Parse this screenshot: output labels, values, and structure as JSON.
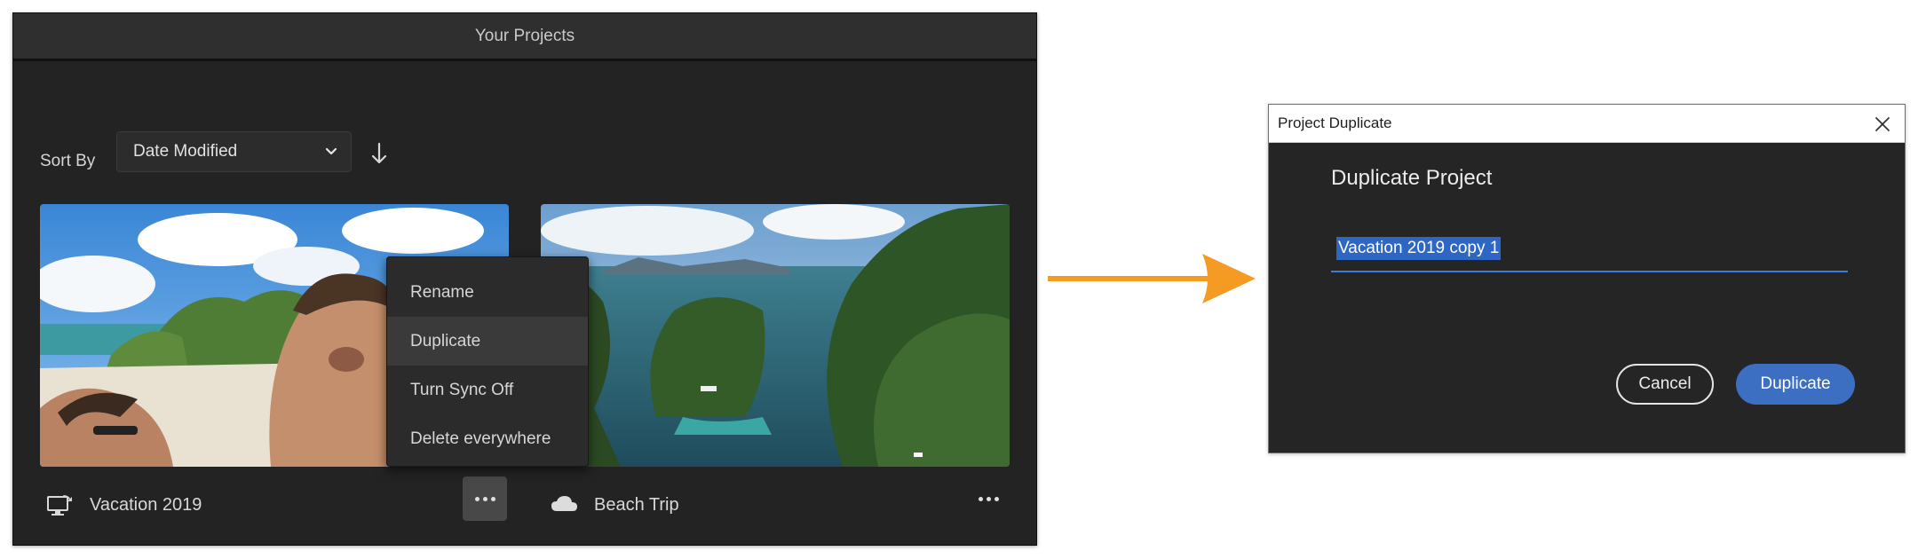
{
  "projects_panel": {
    "title": "Your Projects",
    "sort_label": "Sort By",
    "sort_value": "Date Modified",
    "sort_icon": "chevron-down-icon",
    "sort_direction_icon": "arrow-down-icon",
    "projects": [
      {
        "name": "Vacation 2019",
        "icon": "desktop-sync-icon",
        "more_icon": "more-icon"
      },
      {
        "name": "Beach Trip",
        "icon": "cloud-icon",
        "more_icon": "more-icon"
      }
    ],
    "context_menu": {
      "items": [
        "Rename",
        "Duplicate",
        "Turn Sync Off",
        "Delete everywhere"
      ],
      "highlighted": "Duplicate"
    }
  },
  "flow_arrow": {
    "color": "#f59a23"
  },
  "dialog": {
    "window_title": "Project Duplicate",
    "close_icon": "close-icon",
    "heading": "Duplicate Project",
    "name_value": "Vacation 2019 copy 1",
    "cancel_label": "Cancel",
    "confirm_label": "Duplicate",
    "accent_color": "#3c6fc2"
  }
}
